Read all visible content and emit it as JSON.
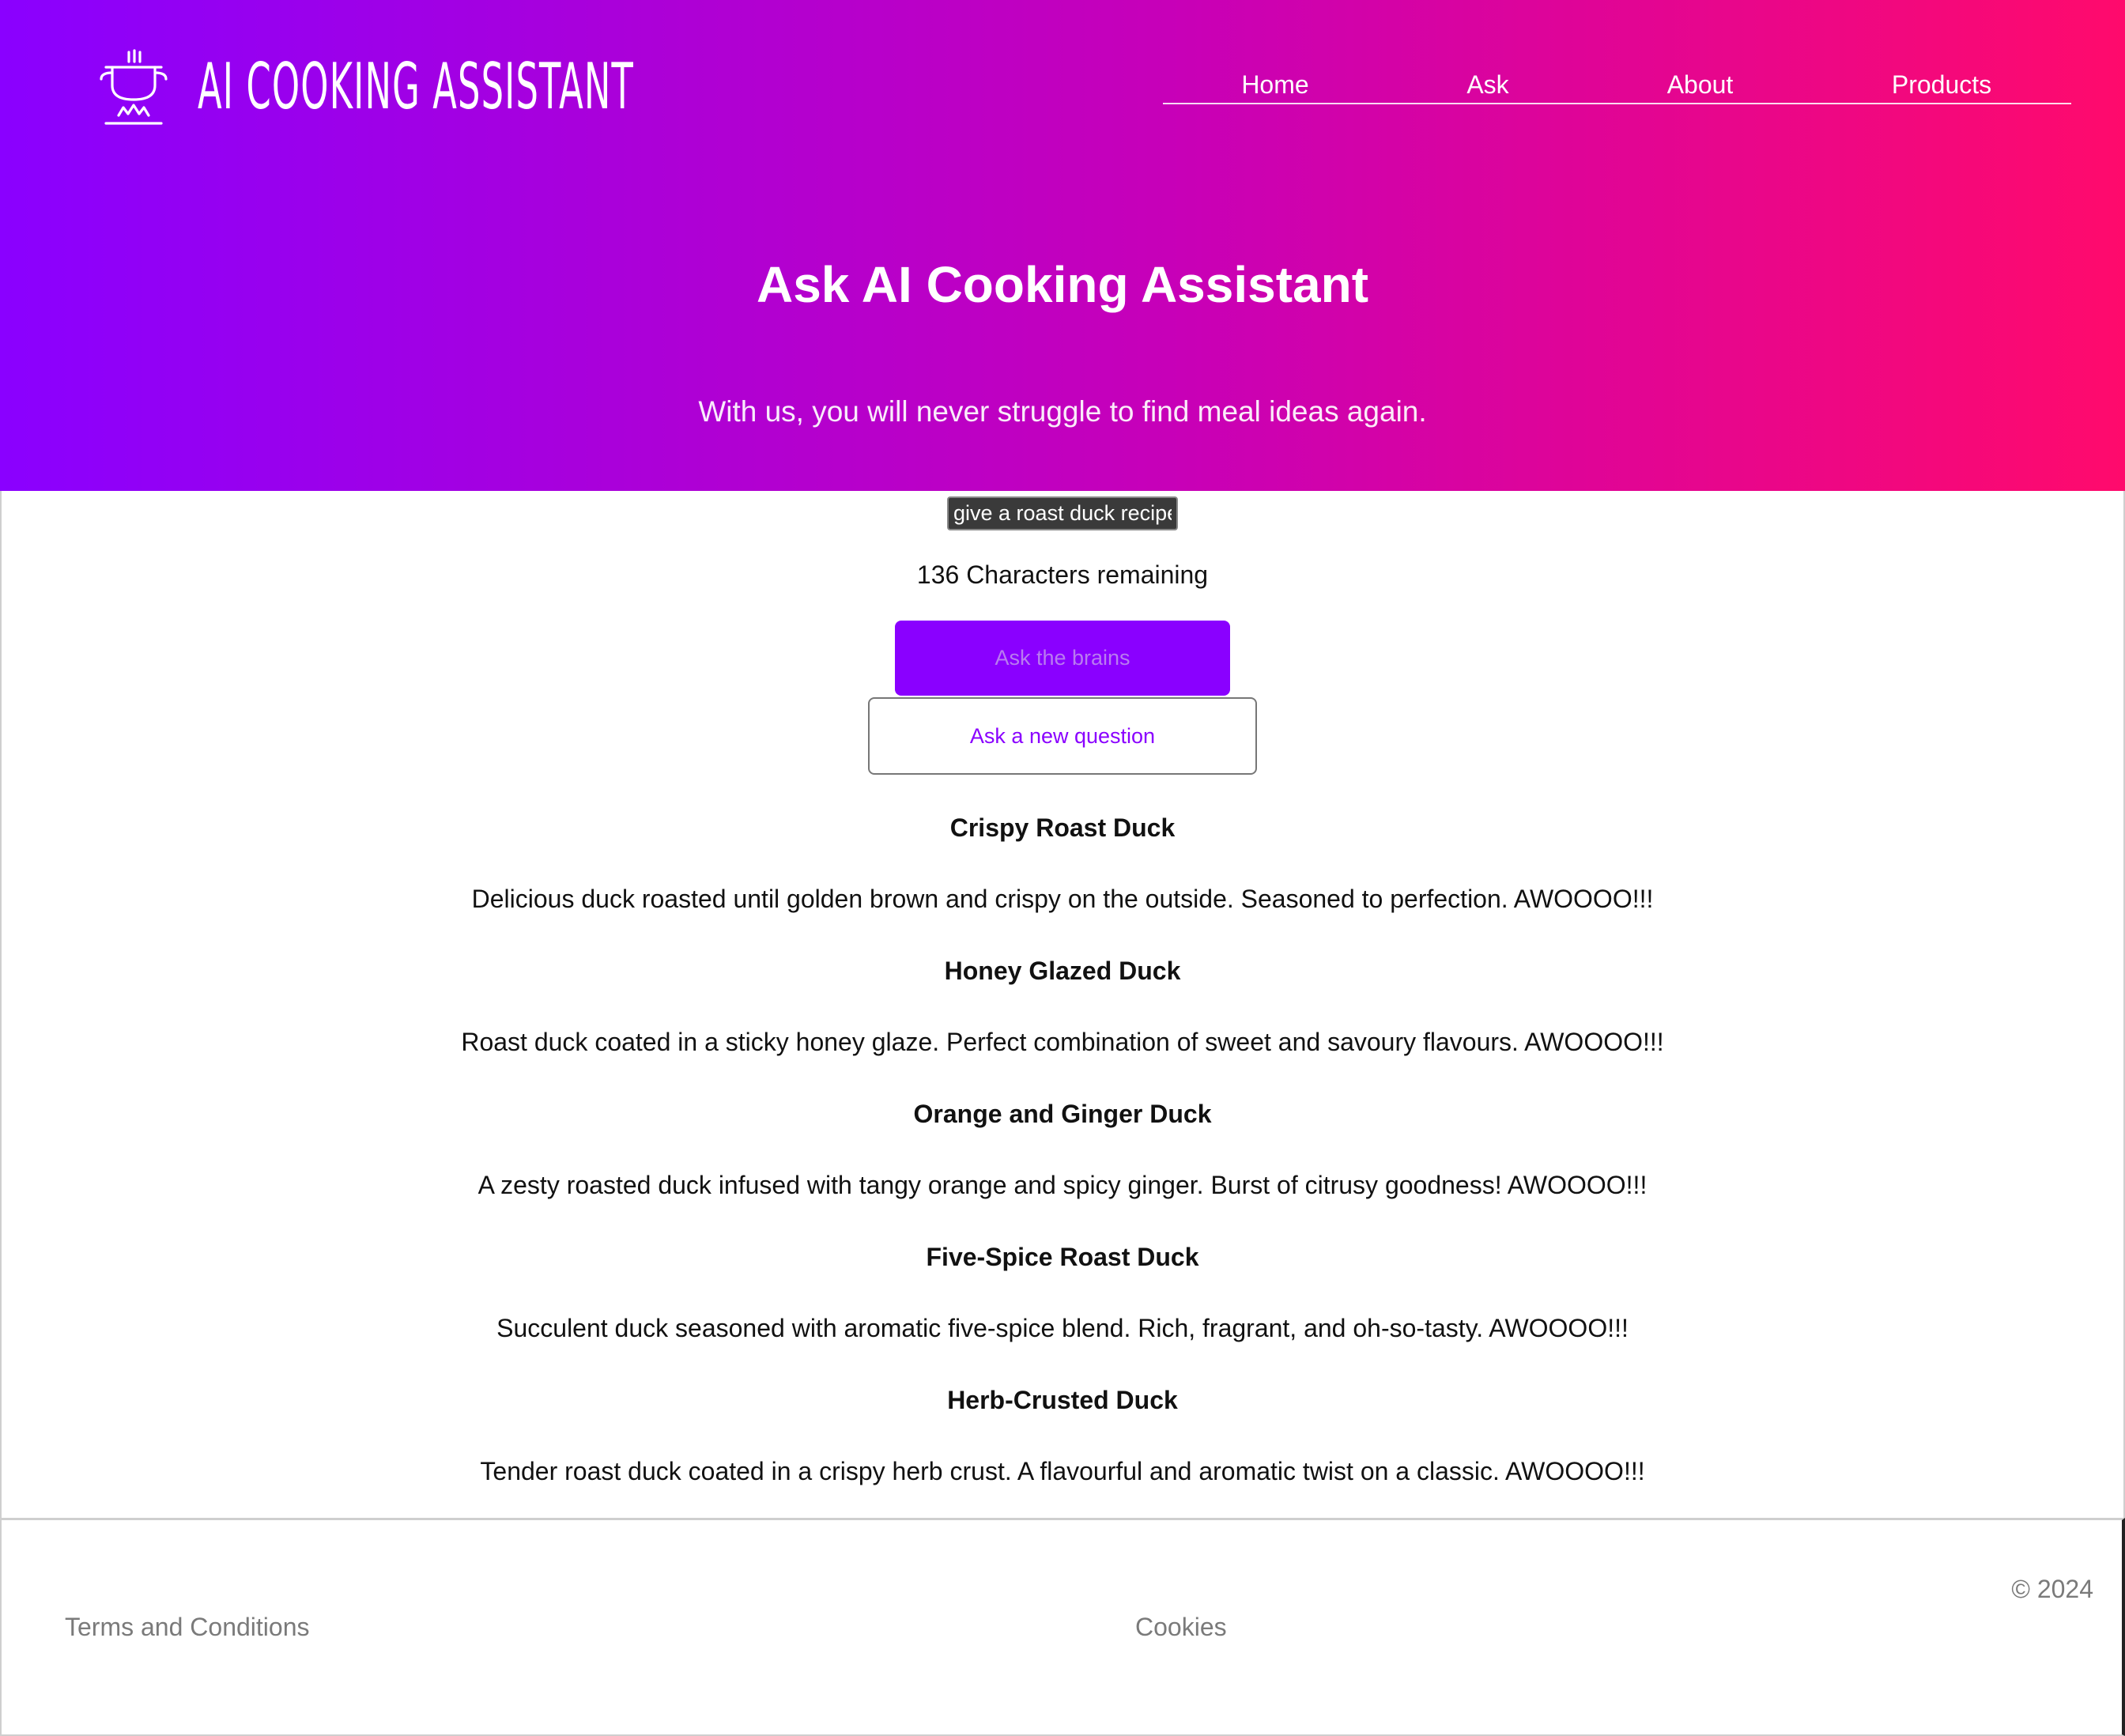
{
  "header": {
    "brand": "AI COOKING ASSISTANT",
    "logo_icon": "cooking-pot-icon",
    "nav": [
      "Home",
      "Ask",
      "About",
      "Products"
    ],
    "title": "Ask AI Cooking Assistant",
    "subtitle": "With us, you will never struggle to find meal ideas again.",
    "gradient": [
      "#8a00ff",
      "#ff0a6c"
    ]
  },
  "main": {
    "query_value": "give a roast duck recipe",
    "remaining": "136 Characters remaining",
    "ask_button": "Ask the brains",
    "new_question_button": "Ask a new question",
    "accent": "#8a00ff",
    "recipes": [
      {
        "title": "Crispy Roast Duck",
        "description": "Delicious duck roasted until golden brown and crispy on the outside. Seasoned to perfection. AWOOOO!!!"
      },
      {
        "title": "Honey Glazed Duck",
        "description": "Roast duck coated in a sticky honey glaze. Perfect combination of sweet and savoury flavours. AWOOOO!!!"
      },
      {
        "title": "Orange and Ginger Duck",
        "description": "A zesty roasted duck infused with tangy orange and spicy ginger. Burst of citrusy goodness! AWOOOO!!!"
      },
      {
        "title": "Five-Spice Roast Duck",
        "description": "Succulent duck seasoned with aromatic five-spice blend. Rich, fragrant, and oh-so-tasty. AWOOOO!!!"
      },
      {
        "title": "Herb-Crusted Duck",
        "description": "Tender roast duck coated in a crispy herb crust. A flavourful and aromatic twist on a classic. AWOOOO!!!"
      }
    ]
  },
  "footer": {
    "terms": "Terms and Conditions",
    "cookies": "Cookies",
    "copyright": "© 2024"
  }
}
